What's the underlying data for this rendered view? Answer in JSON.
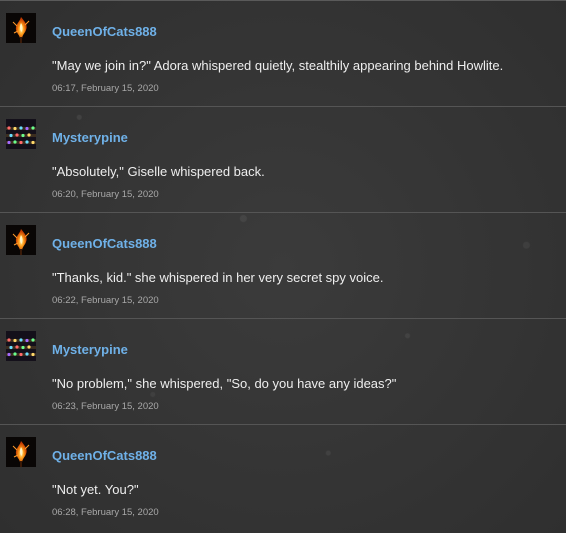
{
  "comments": [
    {
      "username": "QueenOfCats888",
      "avatar_icon": "flame-avatar-icon",
      "text": "\"May we join in?\" Adora whispered quietly, stealthily appearing behind Howlite.",
      "timestamp": "06:17, February 15, 2020"
    },
    {
      "username": "Mysterypine",
      "avatar_icon": "lights-avatar-icon",
      "text": "\"Absolutely,\" Giselle whispered back.",
      "timestamp": "06:20, February 15, 2020"
    },
    {
      "username": "QueenOfCats888",
      "avatar_icon": "flame-avatar-icon",
      "text": "\"Thanks, kid.\" she whispered in her very secret spy voice.",
      "timestamp": "06:22, February 15, 2020"
    },
    {
      "username": "Mysterypine",
      "avatar_icon": "lights-avatar-icon",
      "text": "\"No problem,\" she whispered, \"So, do you have any ideas?\"",
      "timestamp": "06:23, February 15, 2020"
    },
    {
      "username": "QueenOfCats888",
      "avatar_icon": "flame-avatar-icon",
      "text": "\"Not yet. You?\"",
      "timestamp": "06:28, February 15, 2020"
    }
  ],
  "colors": {
    "background": "#343434",
    "username": "#6fb1e8",
    "text": "#eeeeee",
    "timestamp": "#a8a8a8",
    "divider": "#555555"
  }
}
